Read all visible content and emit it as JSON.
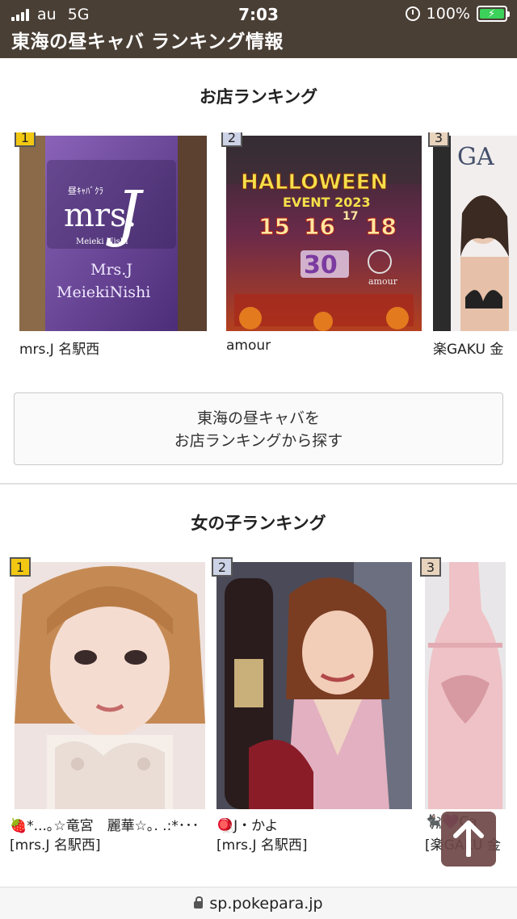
{
  "status_bar": {
    "carrier": "au",
    "network": "5G",
    "time": "7:03",
    "battery": "100%"
  },
  "header": {
    "title": "東海の昼キャバ ランキング情報"
  },
  "shop_ranking": {
    "title": "お店ランキング",
    "items": [
      {
        "rank": "1",
        "name": "mrs.J 名駅西",
        "logo_small": "昼ｷｬﾊﾞｸﾗ",
        "logo_big": "mrs.",
        "logo_letter": "J",
        "logo_sub": "Meieki Nishi",
        "sign_line1": "Mrs.J",
        "sign_line2": "MeiekiNishi"
      },
      {
        "rank": "2",
        "name": "amour",
        "poster_headline": "HALLOWEEN",
        "poster_event": "EVENT 2023",
        "poster_dates": [
          "15",
          "16",
          "17",
          "18"
        ],
        "poster_day30": "30",
        "poster_brand": "amour"
      },
      {
        "rank": "3",
        "name": "楽GAKU 金",
        "poster_text": "GA"
      }
    ],
    "search_button_line1": "東海の昼キャバを",
    "search_button_line2": "お店ランキングから探す"
  },
  "girl_ranking": {
    "title": "女の子ランキング",
    "items": [
      {
        "rank": "1",
        "name": "🍓*...｡☆竜宮　麗華☆｡. .:*･･･",
        "shop": "[mrs.J 名駅西]"
      },
      {
        "rank": "2",
        "name": "🪀J・かよ",
        "shop": "[mrs.J 名駅西]"
      },
      {
        "rank": "3",
        "name": "🐈‍⬛💜Ca",
        "shop": "[楽GAKU 金"
      }
    ]
  },
  "browser": {
    "url": "sp.pokepara.jp"
  },
  "colors": {
    "header_bg": "#4a3f35",
    "rank1": "#f2c812",
    "rank2": "#cdd3e6",
    "rank3": "#e8d3bd",
    "scroll_top_bg": "#6e4646"
  }
}
